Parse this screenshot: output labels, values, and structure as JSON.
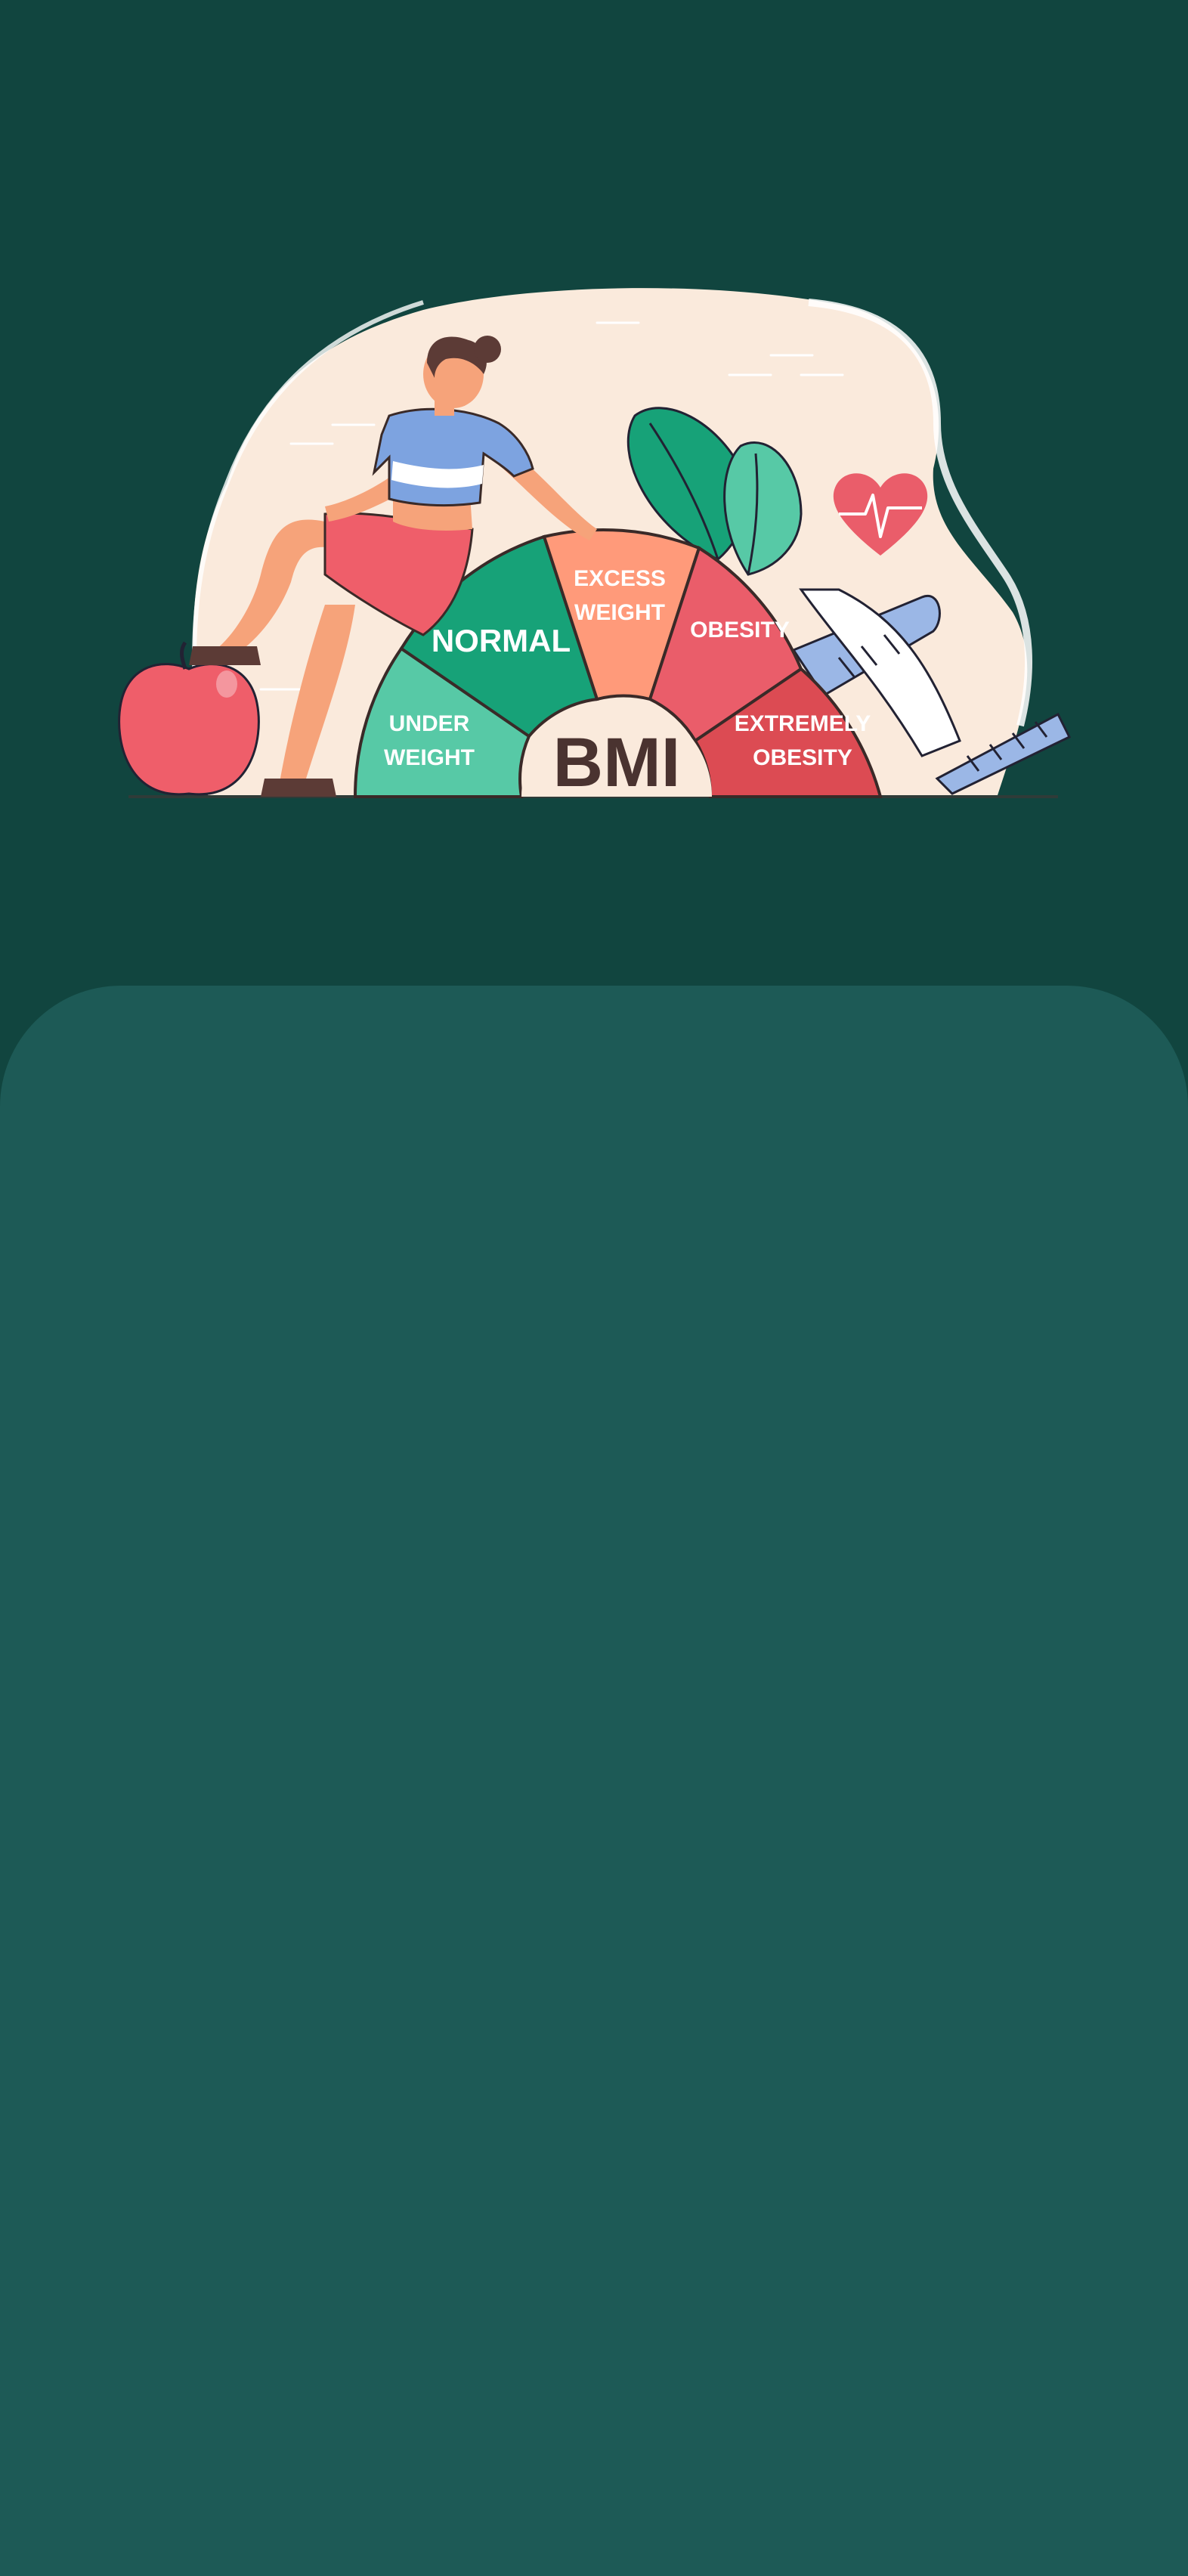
{
  "hero": {
    "gauge": {
      "center_label": "BMI",
      "segments": {
        "under_weight": [
          "UNDER",
          "WEIGHT"
        ],
        "normal": "NORMAL",
        "excess_weight": [
          "EXCESS",
          "WEIGHT"
        ],
        "obesity": "OBESITY",
        "extremely_obesity": [
          "EXTREMELY",
          "OBESITY"
        ]
      }
    }
  },
  "colors": {
    "background": "#11453f",
    "sheet": "#1d5a56",
    "cream": "#faeadc",
    "under_weight": "#57c9a6",
    "normal": "#17a278",
    "excess_weight": "#ff9a7a",
    "obesity": "#ea5d6a",
    "extremely_obesity": "#dc4b53",
    "shirt": "#7da3e0",
    "shorts": "#ef5e6a",
    "tape": "#9bb7e6"
  }
}
